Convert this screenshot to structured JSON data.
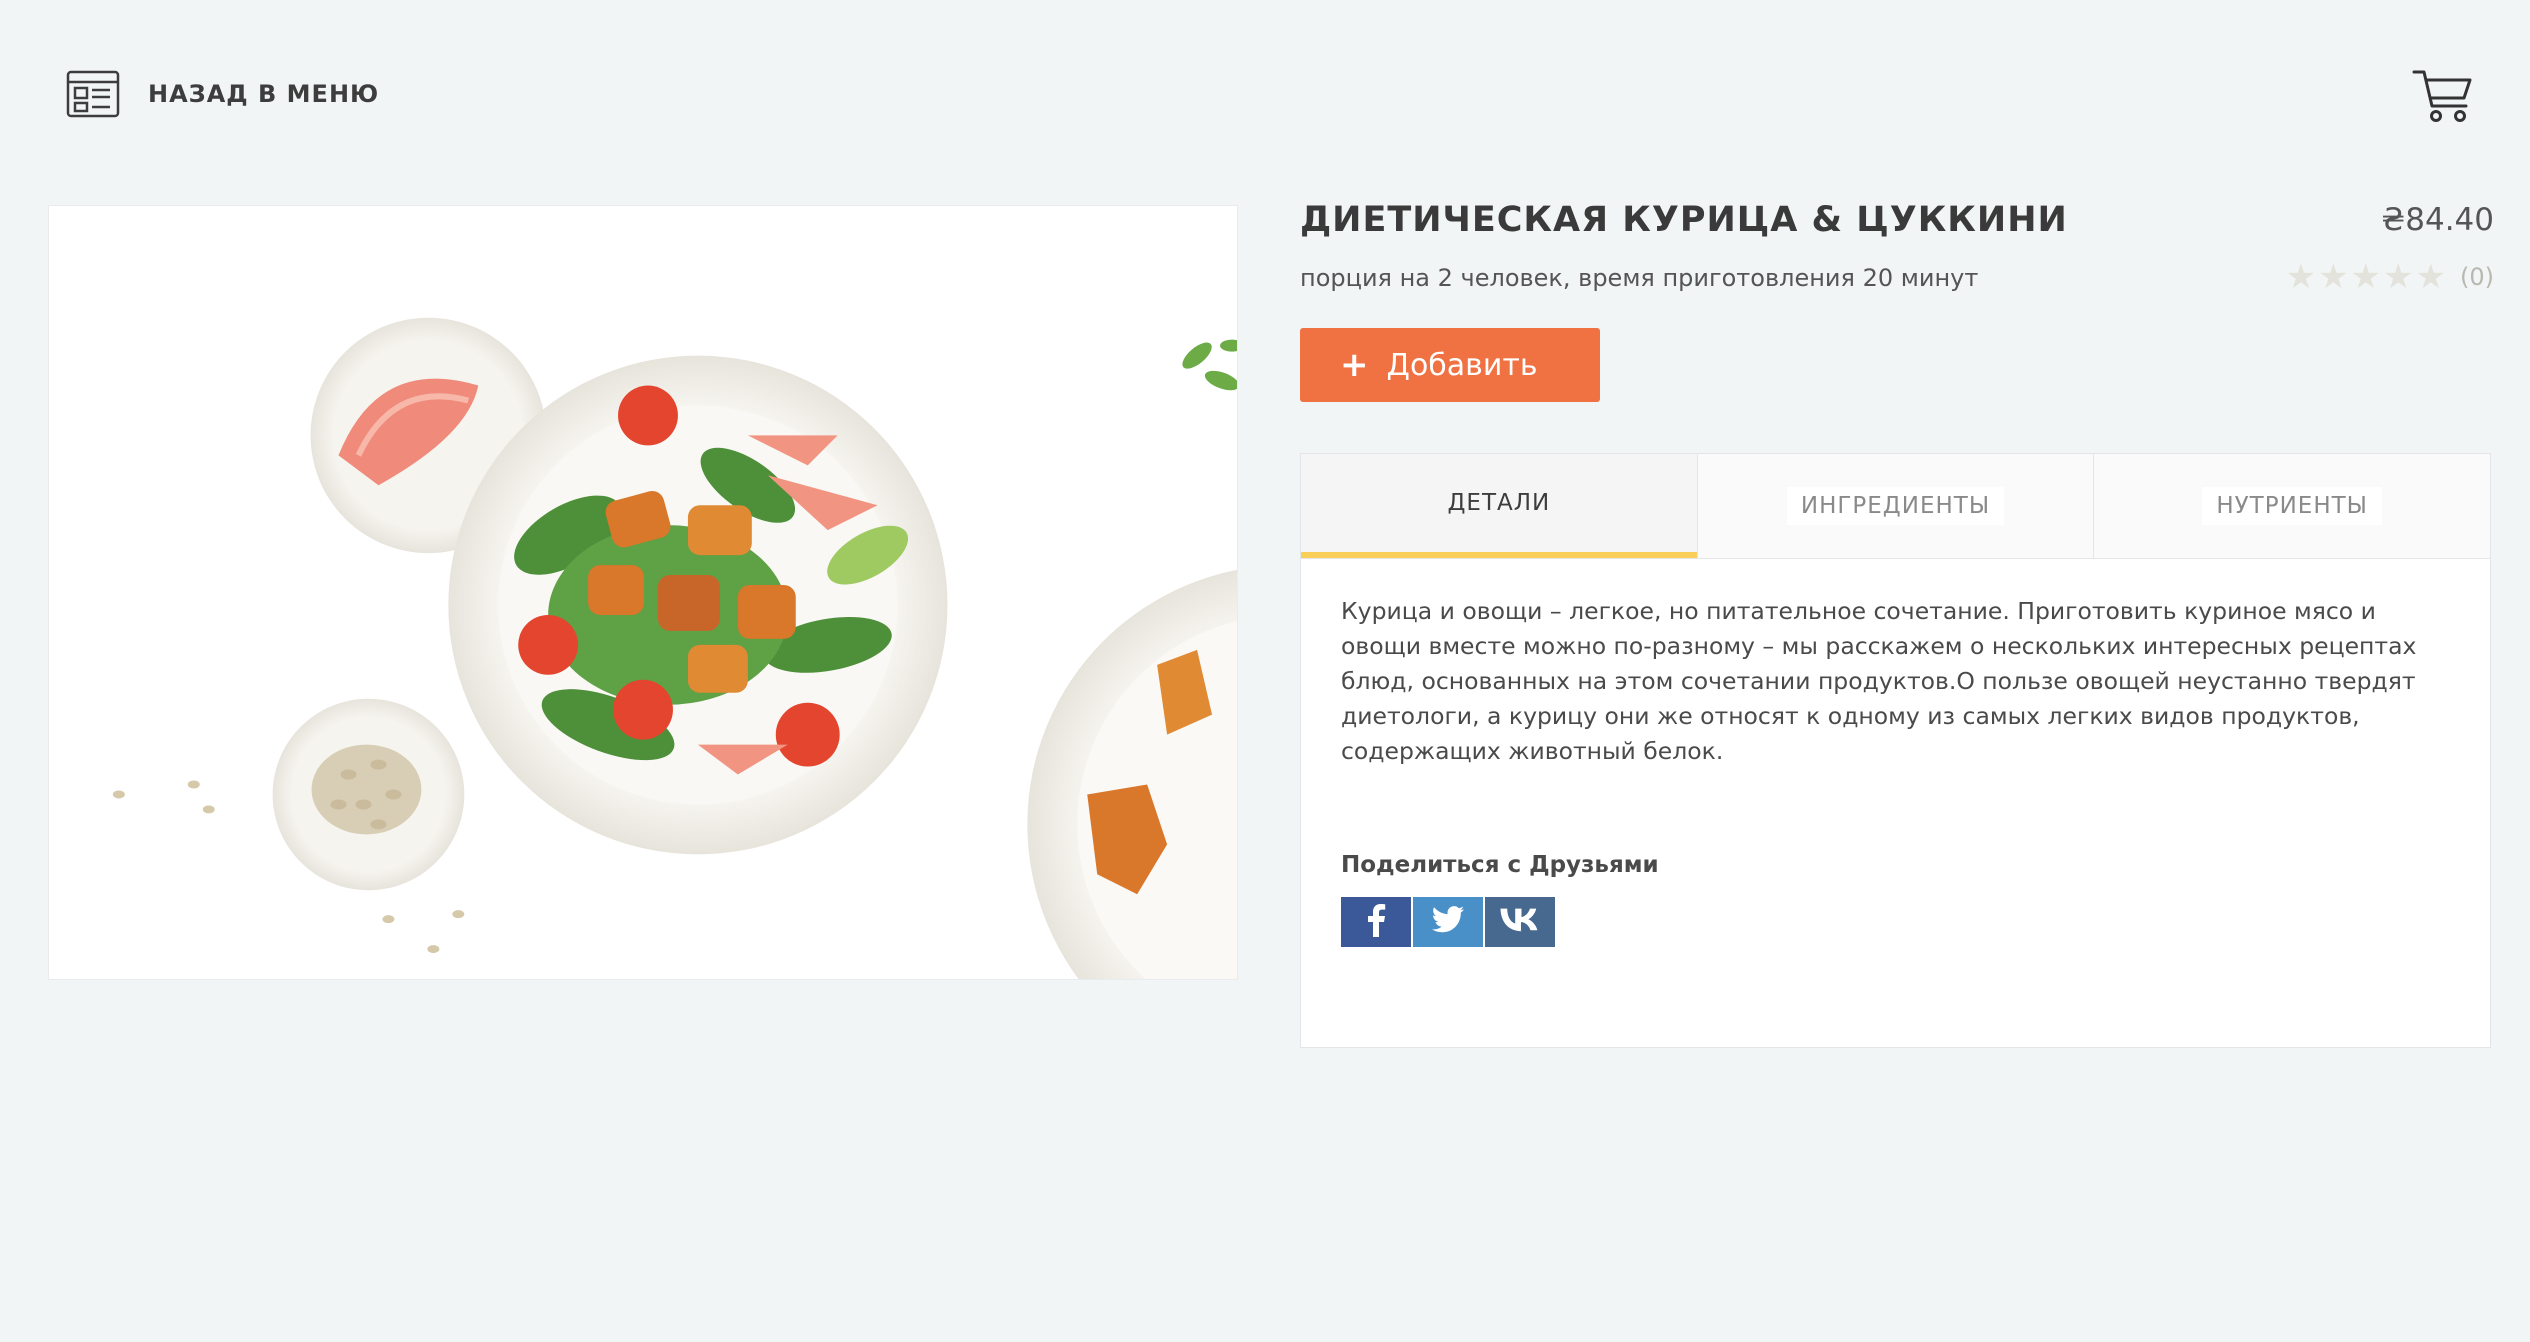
{
  "header": {
    "back_label": "НАЗАД В МЕНЮ",
    "back_icon": "menu-list-icon",
    "cart_icon": "shopping-cart-icon"
  },
  "product": {
    "title": "ДИЕТИЧЕСКАЯ КУРИЦА & ЦУККИНИ",
    "price": "₴84.40",
    "subtitle": "порция на 2 человек, время приготовления 20 минут",
    "rating": {
      "value": 0,
      "max": 5,
      "count_label": "(0)"
    },
    "image": "salad-with-chicken-photo"
  },
  "actions": {
    "add_label": "Добавить",
    "add_icon": "plus-icon"
  },
  "tabs": [
    {
      "label": "ДЕТАЛИ",
      "active": true
    },
    {
      "label": "ИНГРЕДИЕНТЫ",
      "active": false
    },
    {
      "label": "НУТРИЕНТЫ",
      "active": false
    }
  ],
  "details": {
    "description": "Курица и овощи – легкое, но питательное сочетание. Приготовить куриное мясо и овощи вместе можно по-разному – мы расскажем о нескольких интересных рецептах блюд, основанных на этом сочетании продуктов.О пользе овощей неустанно твердят диетологи, а курицу они же относят к одному из самых легких видов продуктов, содержащих животный белок.",
    "share_title": "Поделиться с Друзьями",
    "share_buttons": [
      {
        "icon": "facebook-icon"
      },
      {
        "icon": "twitter-icon"
      },
      {
        "icon": "vk-icon"
      }
    ]
  },
  "colors": {
    "accent": "#f07142",
    "tab_underline": "#f9cf5a",
    "background": "#f2f5f6",
    "facebook": "#3b5998",
    "twitter": "#4a90c8",
    "vk": "#47698f"
  }
}
